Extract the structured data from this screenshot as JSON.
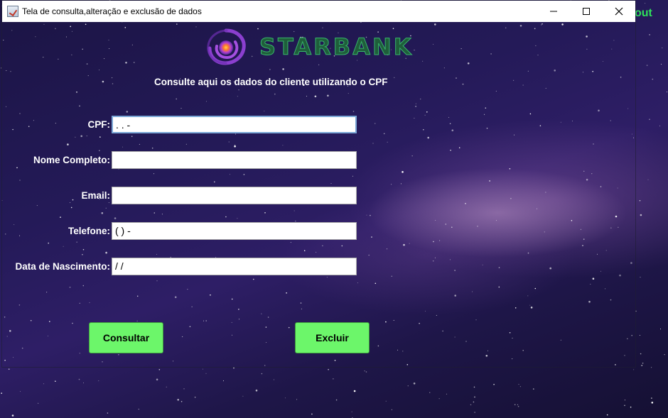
{
  "window": {
    "title": "Tela de consulta,alteração e exclusão de dados",
    "minimize_icon": "minimize-icon",
    "maximize_icon": "maximize-icon",
    "close_icon": "close-icon"
  },
  "background_text": "out",
  "brand": {
    "name": "STARBANK",
    "logo_icon": "galaxy-swirl-icon",
    "colors": {
      "text": "#1f5e3b",
      "outline": "#37b56a",
      "logo": "#8b3fcf"
    }
  },
  "subtitle": "Consulte aqui os dados do cliente utilizando o CPF",
  "form": {
    "cpf": {
      "label": "CPF:",
      "value": "   .   .   -"
    },
    "nome": {
      "label": "Nome Completo:",
      "value": ""
    },
    "email": {
      "label": "Email:",
      "value": ""
    },
    "telefone": {
      "label": "Telefone:",
      "value": "(  )     -"
    },
    "nascimento": {
      "label": "Data de Nascimento:",
      "value": "  /  /"
    }
  },
  "buttons": {
    "consultar": "Consultar",
    "excluir": "Excluir",
    "color": "#6cf66a"
  }
}
